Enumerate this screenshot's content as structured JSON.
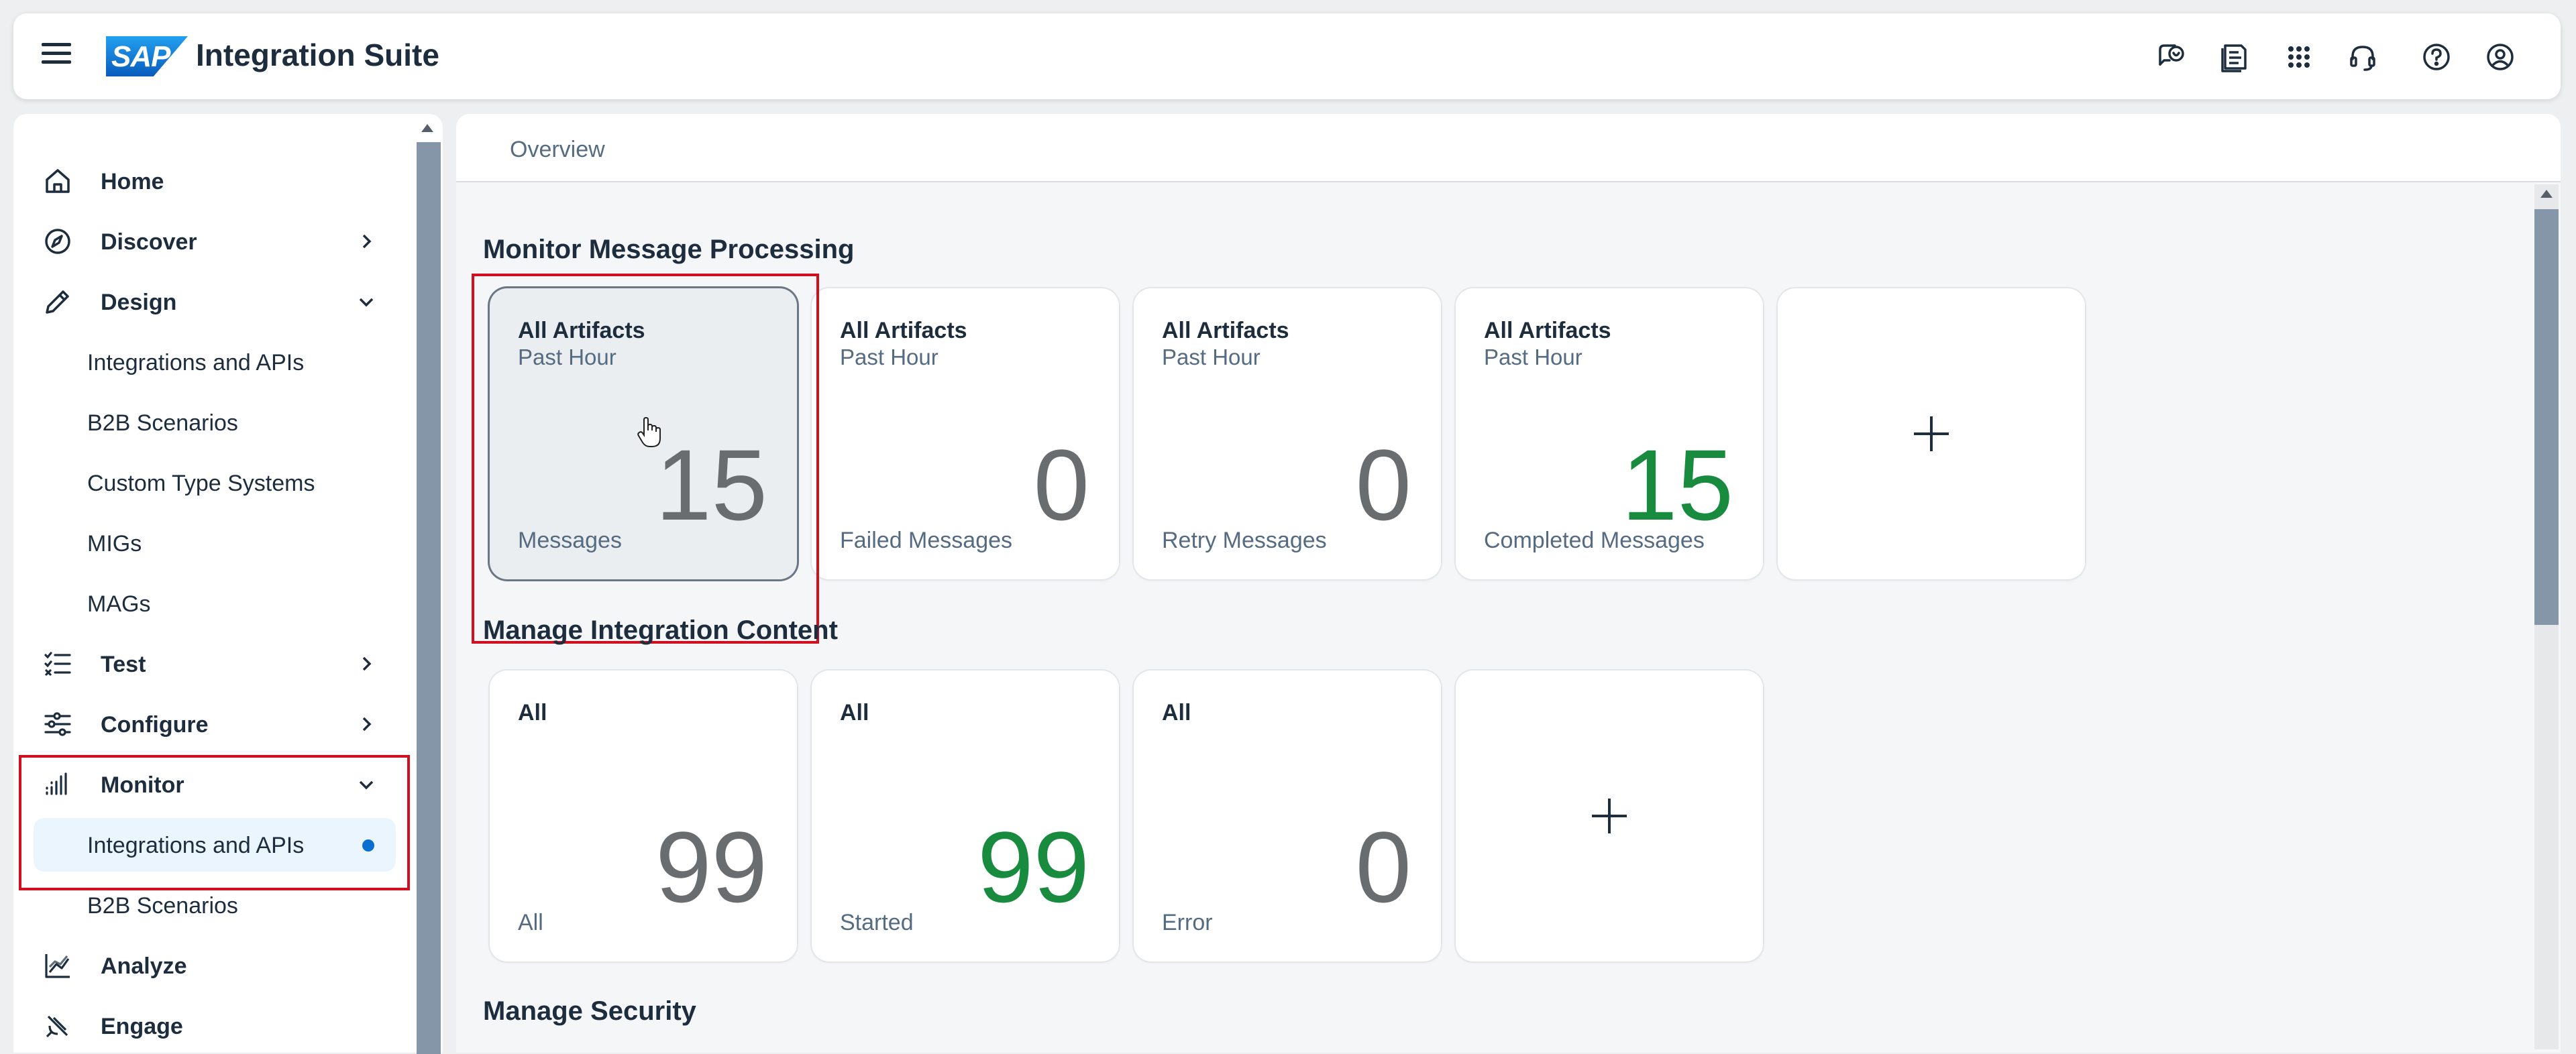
{
  "header": {
    "logo_text": "SAP",
    "title": "Integration Suite",
    "icons": [
      "feedback-icon",
      "notes-icon",
      "grid-apps-icon",
      "headset-support-icon",
      "help-icon",
      "user-profile-icon"
    ]
  },
  "sidebar": {
    "items": [
      {
        "label": "Home",
        "icon": "home-icon"
      },
      {
        "label": "Discover",
        "icon": "compass-icon",
        "state": "collapsed"
      },
      {
        "label": "Design",
        "icon": "pencil-icon",
        "state": "expanded"
      },
      {
        "label": "Test",
        "icon": "checklist-icon",
        "state": "collapsed"
      },
      {
        "label": "Configure",
        "icon": "sliders-icon",
        "state": "collapsed"
      },
      {
        "label": "Monitor",
        "icon": "bar-chart-icon",
        "state": "expanded"
      },
      {
        "label": "Analyze",
        "icon": "line-chart-icon"
      },
      {
        "label": "Engage",
        "icon": "satellite-icon"
      }
    ],
    "design_children": [
      "Integrations and APIs",
      "B2B Scenarios",
      "Custom Type Systems",
      "MIGs",
      "MAGs"
    ],
    "monitor_children": [
      "Integrations and APIs",
      "B2B Scenarios"
    ],
    "selected": "Integrations and APIs"
  },
  "tabs": {
    "overview": "Overview"
  },
  "sections": {
    "monitor": "Monitor Message Processing",
    "manage": "Manage Integration Content",
    "security": "Manage Security"
  },
  "monitor_tiles": [
    {
      "title": "All Artifacts",
      "subtitle": "Past Hour",
      "value": "15",
      "footer": "Messages",
      "color": "neutral"
    },
    {
      "title": "All Artifacts",
      "subtitle": "Past Hour",
      "value": "0",
      "footer": "Failed Messages",
      "color": "neutral"
    },
    {
      "title": "All Artifacts",
      "subtitle": "Past Hour",
      "value": "0",
      "footer": "Retry Messages",
      "color": "neutral"
    },
    {
      "title": "All Artifacts",
      "subtitle": "Past Hour",
      "value": "15",
      "footer": "Completed Messages",
      "color": "#188b3e"
    }
  ],
  "content_tiles": [
    {
      "title": "All",
      "value": "99",
      "footer": "All",
      "color": "neutral"
    },
    {
      "title": "All",
      "value": "99",
      "footer": "Started",
      "color": "#188b3e"
    },
    {
      "title": "All",
      "value": "0",
      "footer": "Error",
      "color": "neutral"
    }
  ],
  "add_tile_icon": "plus-icon",
  "colors": {
    "accent": "#0a6ed1",
    "positive": "#188b3e",
    "highlight_border": "#d0101f"
  }
}
